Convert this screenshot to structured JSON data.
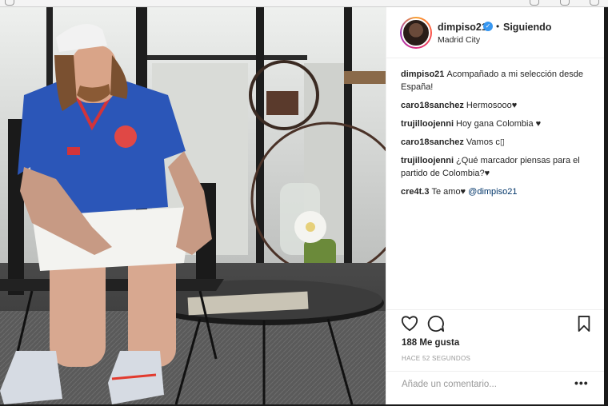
{
  "post": {
    "username": "dimpiso21",
    "follow_dot": "•",
    "follow_label": "Siguiendo",
    "location": "Madrid City",
    "verified_glyph": "✓",
    "caption": {
      "user": "dimpiso21",
      "text": "Acompañado a mi selección desde España!"
    },
    "comments": [
      {
        "user": "caro18sanchez",
        "text": "Hermosooo♥"
      },
      {
        "user": "trujilloojenni",
        "text": "Hoy gana Colombia ♥"
      },
      {
        "user": "caro18sanchez",
        "text": "Vamos c▯"
      },
      {
        "user": "trujilloojenni",
        "text": "¿Qué marcador piensas para el partido de Colombia?♥"
      },
      {
        "user": "cre4t.3",
        "text": "Te amo♥",
        "mention": "@dimpiso21"
      }
    ],
    "likes": "188 Me gusta",
    "time_ago": "HACE 52 SEGUNDOS",
    "comment_placeholder": "Añade un comentario...",
    "more_label": "•••",
    "icons": [
      "heart-icon",
      "comment-icon",
      "bookmark-icon"
    ],
    "colors": {
      "verified": "#3897f0",
      "text": "#262626",
      "muted": "#999999",
      "mention": "#003569"
    }
  }
}
